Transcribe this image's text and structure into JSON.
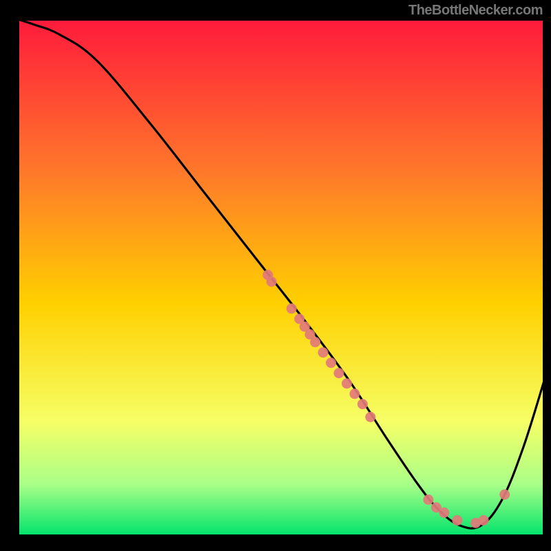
{
  "watermark": "TheBottleNecker.com",
  "chart_data": {
    "type": "line",
    "title": "",
    "xlabel": "",
    "ylabel": "",
    "xlim": [
      0,
      100
    ],
    "ylim": [
      0,
      100
    ],
    "background": {
      "type": "vertical-gradient",
      "stops": [
        {
          "offset": 0.0,
          "color": "#ff1a3c"
        },
        {
          "offset": 0.3,
          "color": "#ff7a2a"
        },
        {
          "offset": 0.55,
          "color": "#ffd000"
        },
        {
          "offset": 0.78,
          "color": "#f5ff66"
        },
        {
          "offset": 0.9,
          "color": "#aaff88"
        },
        {
          "offset": 1.0,
          "color": "#00e36b"
        }
      ]
    },
    "series": [
      {
        "name": "bottleneck-curve",
        "x": [
          0,
          3,
          8,
          15,
          25,
          35,
          45,
          55,
          63,
          70,
          76,
          80,
          84,
          88,
          92,
          96,
          100
        ],
        "y": [
          100,
          99,
          97,
          92,
          80,
          67,
          54,
          41,
          30,
          19,
          10,
          5,
          2,
          2,
          7,
          17,
          30
        ]
      }
    ],
    "markers": {
      "name": "data-points",
      "color": "#e27a7a",
      "points": [
        {
          "x": 47.5,
          "y": 50.5
        },
        {
          "x": 48.2,
          "y": 49.2
        },
        {
          "x": 52.0,
          "y": 44.0
        },
        {
          "x": 53.5,
          "y": 42.0
        },
        {
          "x": 54.5,
          "y": 40.5
        },
        {
          "x": 55.5,
          "y": 39.0
        },
        {
          "x": 56.5,
          "y": 37.5
        },
        {
          "x": 58.0,
          "y": 35.5
        },
        {
          "x": 59.5,
          "y": 33.5
        },
        {
          "x": 61.0,
          "y": 31.5
        },
        {
          "x": 62.5,
          "y": 29.5
        },
        {
          "x": 64.0,
          "y": 27.5
        },
        {
          "x": 65.5,
          "y": 25.5
        },
        {
          "x": 67.0,
          "y": 23.0
        },
        {
          "x": 78.0,
          "y": 7.0
        },
        {
          "x": 79.5,
          "y": 5.5
        },
        {
          "x": 81.0,
          "y": 4.5
        },
        {
          "x": 83.5,
          "y": 3.0
        },
        {
          "x": 87.0,
          "y": 2.5
        },
        {
          "x": 88.5,
          "y": 3.0
        },
        {
          "x": 92.5,
          "y": 8.0
        }
      ]
    }
  }
}
